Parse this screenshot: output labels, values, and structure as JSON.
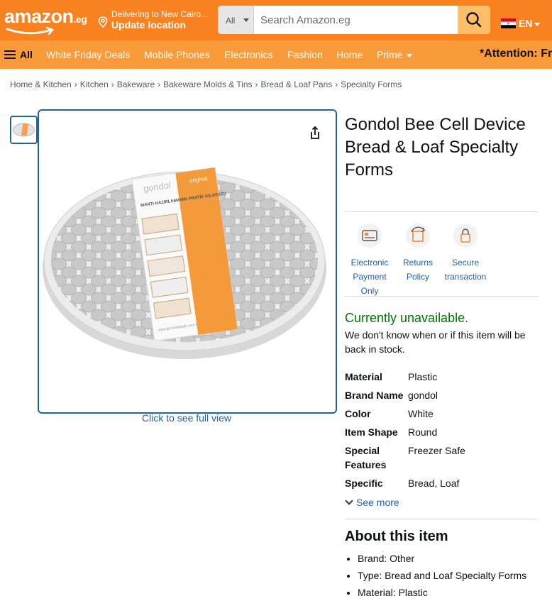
{
  "header": {
    "logo_text": "amazon",
    "logo_tld": ".eg",
    "deliver_line1": "Delivering to New Cairo...",
    "deliver_line2": "Update location",
    "search_category": "All",
    "search_placeholder": "Search Amazon.eg",
    "language": "EN"
  },
  "nav": {
    "all_label": "All",
    "items": [
      "White Friday Deals",
      "Mobile Phones",
      "Electronics",
      "Fashion",
      "Home",
      "Prime"
    ],
    "attention": "*Attention: Fr"
  },
  "breadcrumb": [
    "Home & Kitchen",
    "Kitchen",
    "Bakeware",
    "Bakeware Molds & Tins",
    "Bread & Loaf Pans",
    "Specialty Forms"
  ],
  "breadcrumb_sep": "›",
  "gallery": {
    "full_view_link": "Click to see full view",
    "package_brand": "gondol",
    "package_badge": "original",
    "package_heading": "MANTI HAZIRLAMANIN PRATİK KILAVUZU",
    "package_site": "www.gondolplastik.com.tr"
  },
  "product": {
    "title": "Gondol Bee Cell Device Bread & Loaf Specialty Forms",
    "badges": [
      {
        "icon": "card-icon",
        "label": "Electronic Payment Only"
      },
      {
        "icon": "returns-icon",
        "label": "Returns Policy"
      },
      {
        "icon": "lock-icon",
        "label": "Secure transaction"
      }
    ],
    "availability": "Currently unavailable.",
    "availability_note": "We don't know when or if this item will be back in stock.",
    "specs": [
      {
        "key": "Material",
        "value": "Plastic"
      },
      {
        "key": "Brand Name",
        "value": "gondol"
      },
      {
        "key": "Color",
        "value": "White"
      },
      {
        "key": "Item Shape",
        "value": "Round"
      },
      {
        "key": "Special Features",
        "value": "Freezer Safe"
      },
      {
        "key": "Specific Uses",
        "value": "Bread, Loaf"
      }
    ],
    "see_more": "See more",
    "about_heading": "About this item",
    "about_bullets": [
      "Brand: Other",
      "Type: Bread and Loaf Specialty Forms",
      "Material: Plastic"
    ]
  },
  "colors": {
    "nav_top": "#f7821f",
    "nav_belt": "#f99b3b",
    "link": "#2162a1",
    "availability": "#007600"
  }
}
